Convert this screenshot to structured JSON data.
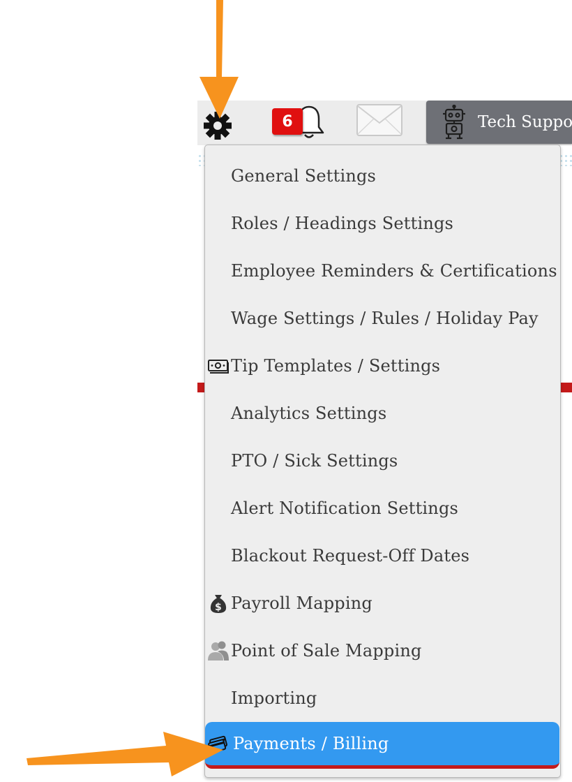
{
  "header": {
    "notification_count": "6",
    "tech_support_label": "Tech Support"
  },
  "icons": {
    "settings": "gear-icon",
    "notifications": "bell-icon",
    "messages": "envelope-icon",
    "tech_support": "robot-icon",
    "tip_templates": "money-icon",
    "payroll": "money-bag-icon",
    "pos": "people-icon",
    "payments": "credit-card-icon"
  },
  "menu": {
    "items": [
      {
        "label": "General Settings"
      },
      {
        "label": "Roles / Headings Settings"
      },
      {
        "label": "Employee Reminders & Certifications"
      },
      {
        "label": "Wage Settings / Rules / Holiday Pay"
      },
      {
        "label": "Tip Templates / Settings"
      },
      {
        "label": "Analytics Settings"
      },
      {
        "label": "PTO / Sick Settings"
      },
      {
        "label": "Alert Notification Settings"
      },
      {
        "label": "Blackout Request-Off Dates"
      },
      {
        "label": "Payroll Mapping"
      },
      {
        "label": "Point of Sale Mapping"
      },
      {
        "label": "Importing"
      },
      {
        "label": "Payments / Billing",
        "active": true
      }
    ]
  },
  "colors": {
    "active_item": "#3399f0",
    "active_underline": "#c41a1a",
    "badge": "#e01010",
    "annotation_arrow": "#f7931e",
    "tech_support_bg": "#6e7076"
  }
}
